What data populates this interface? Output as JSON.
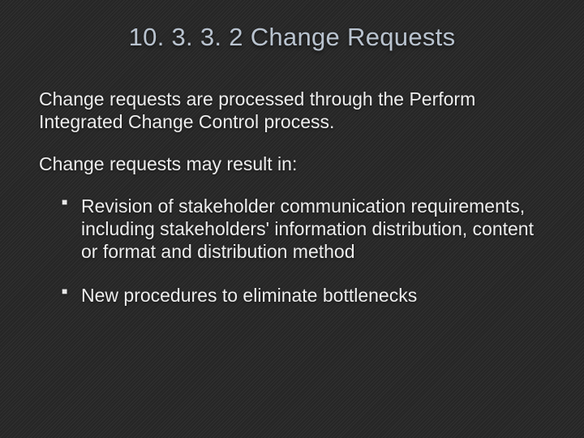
{
  "slide": {
    "title": "10. 3. 3. 2 Change Requests",
    "para1": "Change requests are processed through the Perform Integrated Change Control process.",
    "para2": "Change requests may result in:",
    "bullets": [
      "Revision of stakeholder communication requirements, including stakeholders' information distribution, content or format and distribution method",
      "New procedures to eliminate bottlenecks"
    ]
  }
}
